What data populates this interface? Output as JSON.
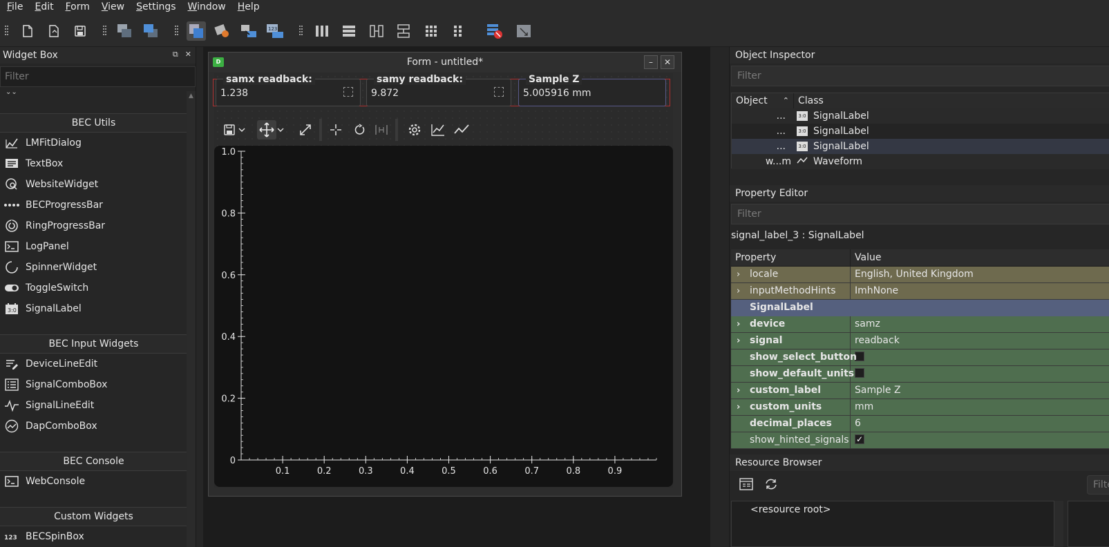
{
  "menu": {
    "file": {
      "mn": "F",
      "rest": "ile"
    },
    "edit": {
      "mn": "E",
      "rest": "dit"
    },
    "form": {
      "mn": "F",
      "rest": "orm"
    },
    "view": {
      "mn": "V",
      "rest": "iew"
    },
    "settings": {
      "mn": "S",
      "rest": "ettings"
    },
    "window": {
      "mn": "W",
      "rest": "indow"
    },
    "help": {
      "mn": "H",
      "rest": "elp"
    }
  },
  "widget_box": {
    "title": "Widget Box",
    "filter_placeholder": "Filter",
    "categories": [
      {
        "name": "BEC Utils",
        "items": [
          "LMFitDialog",
          "TextBox",
          "WebsiteWidget",
          "BECProgressBar",
          "RingProgressBar",
          "LogPanel",
          "SpinnerWidget",
          "ToggleSwitch",
          "SignalLabel"
        ]
      },
      {
        "name": "BEC Input Widgets",
        "items": [
          "DeviceLineEdit",
          "SignalComboBox",
          "SignalLineEdit",
          "DapComboBox"
        ]
      },
      {
        "name": "BEC Console",
        "items": [
          "WebConsole"
        ]
      },
      {
        "name": "Custom Widgets",
        "items": [
          "BECSpinBox"
        ]
      }
    ]
  },
  "form": {
    "title": "Form - untitled*",
    "signal_labels": [
      {
        "title": "samx readback:",
        "value": "1.238"
      },
      {
        "title": "samy readback:",
        "value": "9.872"
      },
      {
        "title": "Sample Z",
        "value": "5.005916 mm"
      }
    ]
  },
  "chart_data": {
    "type": "line",
    "title": "",
    "xlabel": "",
    "ylabel": "",
    "xlim": [
      0,
      1
    ],
    "ylim": [
      0,
      1
    ],
    "x_ticks": [
      "0.1",
      "0.2",
      "0.3",
      "0.4",
      "0.5",
      "0.6",
      "0.7",
      "0.8",
      "0.9"
    ],
    "y_ticks": [
      "0",
      "0.2",
      "0.4",
      "0.6",
      "0.8",
      "1.0"
    ],
    "series": []
  },
  "object_inspector": {
    "title": "Object Inspector",
    "filter_placeholder": "Filter",
    "headers": {
      "object": "Object",
      "class": "Class"
    },
    "rows": [
      {
        "object": "...",
        "class": "SignalLabel"
      },
      {
        "object": "...",
        "class": "SignalLabel"
      },
      {
        "object": "...",
        "class": "SignalLabel"
      },
      {
        "object": "w...m",
        "class": "Waveform"
      }
    ]
  },
  "property_editor": {
    "title": "Property Editor",
    "filter_placeholder": "Filter",
    "object_label": "signal_label_3 : SignalLabel",
    "headers": {
      "property": "Property",
      "value": "Value"
    },
    "rows": [
      {
        "name": "locale",
        "value": "English, United Kingdom"
      },
      {
        "name": "inputMethodHints",
        "value": "ImhNone"
      },
      {
        "name": "SignalLabel",
        "value": ""
      },
      {
        "name": "device",
        "value": "samz"
      },
      {
        "name": "signal",
        "value": "readback"
      },
      {
        "name": "show_select_button",
        "value": ""
      },
      {
        "name": "show_default_units",
        "value": ""
      },
      {
        "name": "custom_label",
        "value": "Sample Z"
      },
      {
        "name": "custom_units",
        "value": "mm"
      },
      {
        "name": "decimal_places",
        "value": "6"
      },
      {
        "name": "show_hinted_signals",
        "value": "✓"
      }
    ]
  },
  "resource_browser": {
    "title": "Resource Browser",
    "filter_placeholder": "Filte",
    "root": "<resource root>"
  }
}
